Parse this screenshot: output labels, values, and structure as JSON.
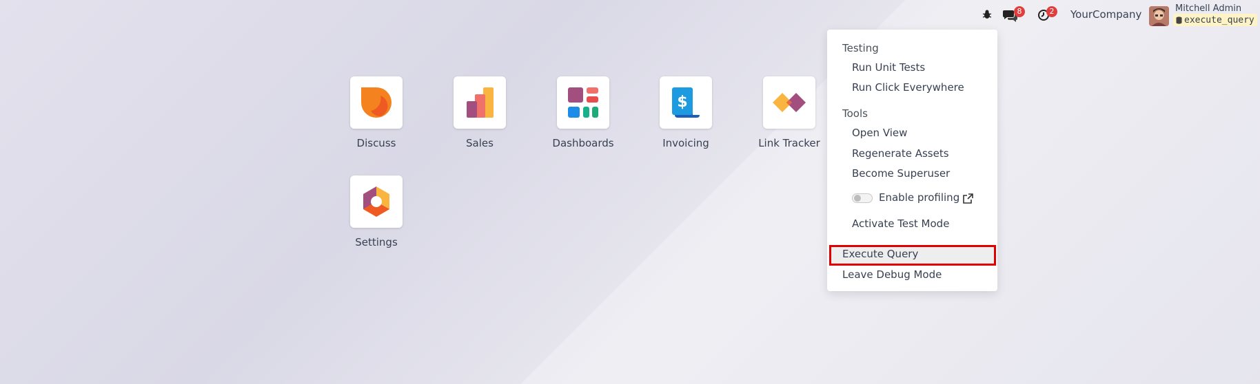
{
  "topbar": {
    "company": "YourCompany",
    "messages_count": "8",
    "activities_count": "2",
    "user_name": "Mitchell Admin",
    "database": "execute_query"
  },
  "apps": [
    {
      "label": "Discuss",
      "icon": "discuss-icon"
    },
    {
      "label": "Sales",
      "icon": "sales-icon"
    },
    {
      "label": "Dashboards",
      "icon": "dashboards-icon"
    },
    {
      "label": "Invoicing",
      "icon": "invoicing-icon"
    },
    {
      "label": "Link Tracker",
      "icon": "link-tracker-icon"
    },
    {
      "label": "Settings",
      "icon": "settings-icon"
    }
  ],
  "debug_menu": {
    "testing_header": "Testing",
    "run_unit_tests": "Run Unit Tests",
    "run_click_everywhere": "Run Click Everywhere",
    "tools_header": "Tools",
    "open_view": "Open View",
    "regenerate_assets": "Regenerate Assets",
    "become_superuser": "Become Superuser",
    "enable_profiling": "Enable profiling",
    "activate_test_mode": "Activate Test Mode",
    "execute_query": "Execute Query",
    "leave_debug_mode": "Leave Debug Mode"
  },
  "colors": {
    "badge": "#e03e3e",
    "highlight_border": "#e00000",
    "text": "#374151"
  }
}
